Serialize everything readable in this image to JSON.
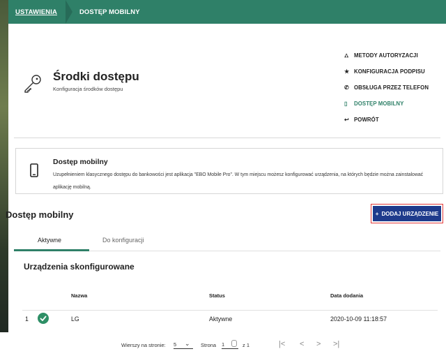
{
  "breadcrumb": {
    "root": "USTAWIENIA",
    "current": "DOSTĘP MOBILNY"
  },
  "hero": {
    "title": "Środki dostępu",
    "subtitle": "Konfiguracja środków dostępu"
  },
  "side_menu": [
    {
      "icon": "sitemap-icon",
      "label": "METODY AUTORYZACJI"
    },
    {
      "icon": "star-icon",
      "label": "KONFIGURACJA PODPISU"
    },
    {
      "icon": "phone-call-icon",
      "label": "OBSŁUGA PRZEZ TELEFON"
    },
    {
      "icon": "mobile-icon",
      "label": "DOSTĘP MOBILNY"
    },
    {
      "icon": "back-arrow-icon",
      "label": "POWRÓT"
    }
  ],
  "info": {
    "title": "Dostęp mobilny",
    "text": "Uzupełnieniem klasycznego dostępu do bankowości jest aplikacja \"EBO Mobile Pro\". W tym miejscu możesz konfigurować urządzenia, na których będzie można zainstalować aplikację mobilną."
  },
  "section": {
    "title": "Dostęp mobilny",
    "add_button": "DODAJ URZĄDZENIE"
  },
  "tabs": [
    {
      "label": "Aktywne"
    },
    {
      "label": "Do konfiguracji"
    }
  ],
  "devices": {
    "title": "Urządzenia skonfigurowane",
    "headers": {
      "name": "Nazwa",
      "status": "Status",
      "date": "Data dodania"
    },
    "rows": [
      {
        "index": "1",
        "name": "LG",
        "status": "Aktywne",
        "date": "2020-10-09 11:18:57"
      }
    ]
  },
  "pager": {
    "rows_label": "Wierszy na stronie:",
    "rows_value": "5",
    "page_label": "Strona",
    "page_value": "1",
    "of_label": "z 1"
  },
  "colors": {
    "accent": "#2f8068",
    "primary_button": "#1f3b8c",
    "highlight_border": "#e23a3a"
  }
}
